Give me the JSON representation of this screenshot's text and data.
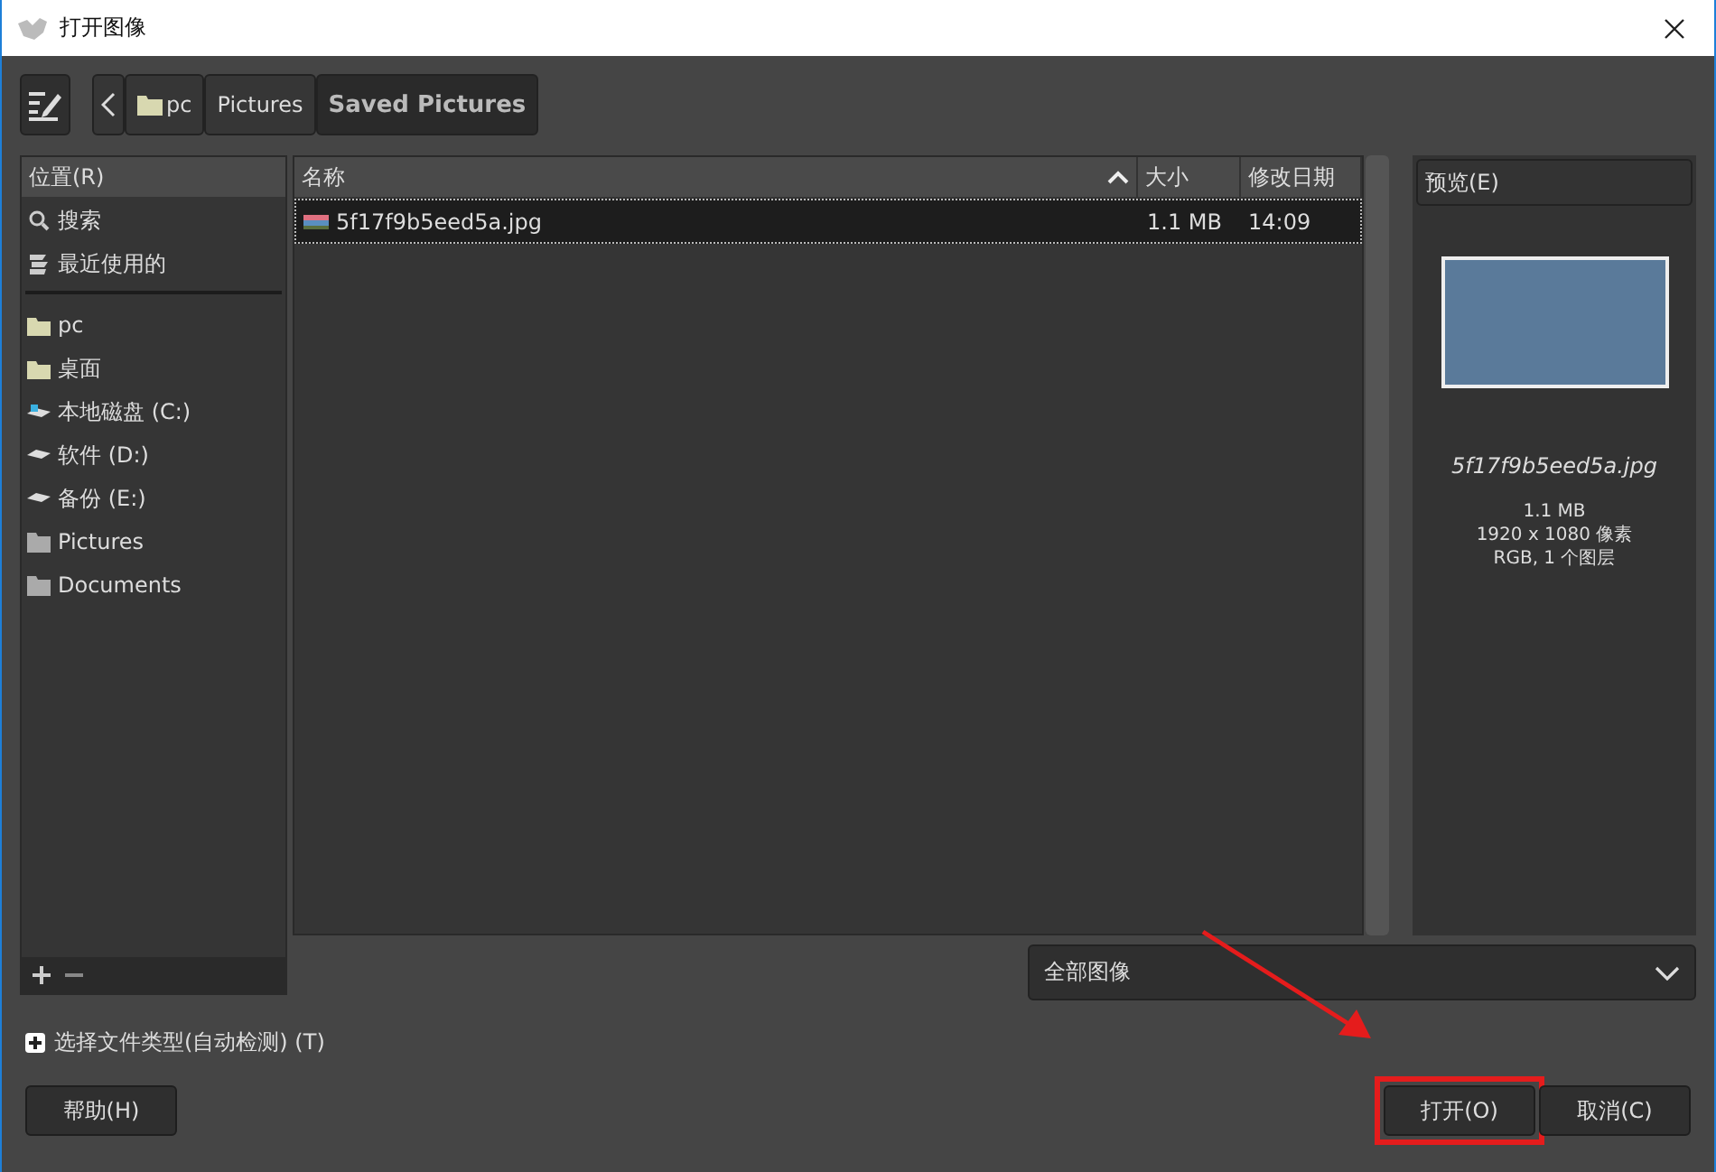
{
  "window": {
    "title": "打开图像"
  },
  "path_bar": [
    {
      "label": "pc",
      "kind": "folder",
      "selected": false
    },
    {
      "label": "Pictures",
      "kind": "plain",
      "selected": false
    },
    {
      "label": "Saved Pictures",
      "kind": "plain",
      "selected": true
    }
  ],
  "places": {
    "header": "位置(R)",
    "groups": [
      [
        {
          "label": "搜索",
          "kind": "search"
        },
        {
          "label": "最近使用的",
          "kind": "recent"
        }
      ],
      [
        {
          "label": "pc",
          "kind": "folder"
        },
        {
          "label": "桌面",
          "kind": "folder"
        },
        {
          "label": "本地磁盘 (C:)",
          "kind": "system-drive"
        },
        {
          "label": "软件 (D:)",
          "kind": "drive"
        },
        {
          "label": "备份 (E:)",
          "kind": "drive"
        },
        {
          "label": "Pictures",
          "kind": "grey-folder"
        },
        {
          "label": "Documents",
          "kind": "grey-folder"
        }
      ]
    ]
  },
  "files": {
    "columns": [
      {
        "label": "名称",
        "sorted": true
      },
      {
        "label": "大小",
        "sorted": false
      },
      {
        "label": "修改日期",
        "sorted": false
      }
    ],
    "rows": [
      {
        "name": "5f17f9b5eed5a.jpg",
        "size": "1.1 MB",
        "modified": "14:09",
        "selected": true
      }
    ]
  },
  "preview": {
    "header": "预览(E)",
    "file_name": "5f17f9b5eed5a.jpg",
    "lines": [
      "1.1 MB",
      "1920 x 1080 像素",
      "RGB, 1 个图层"
    ]
  },
  "filter": {
    "value": "全部图像"
  },
  "file_type_expander": {
    "label": "选择文件类型(自动检测) (T)",
    "expanded": false
  },
  "buttons": [
    {
      "label": "帮助(H)",
      "highlighted": false
    },
    {
      "label": "打开(O)",
      "highlighted": true
    },
    {
      "label": "取消(C)",
      "highlighted": false
    }
  ]
}
